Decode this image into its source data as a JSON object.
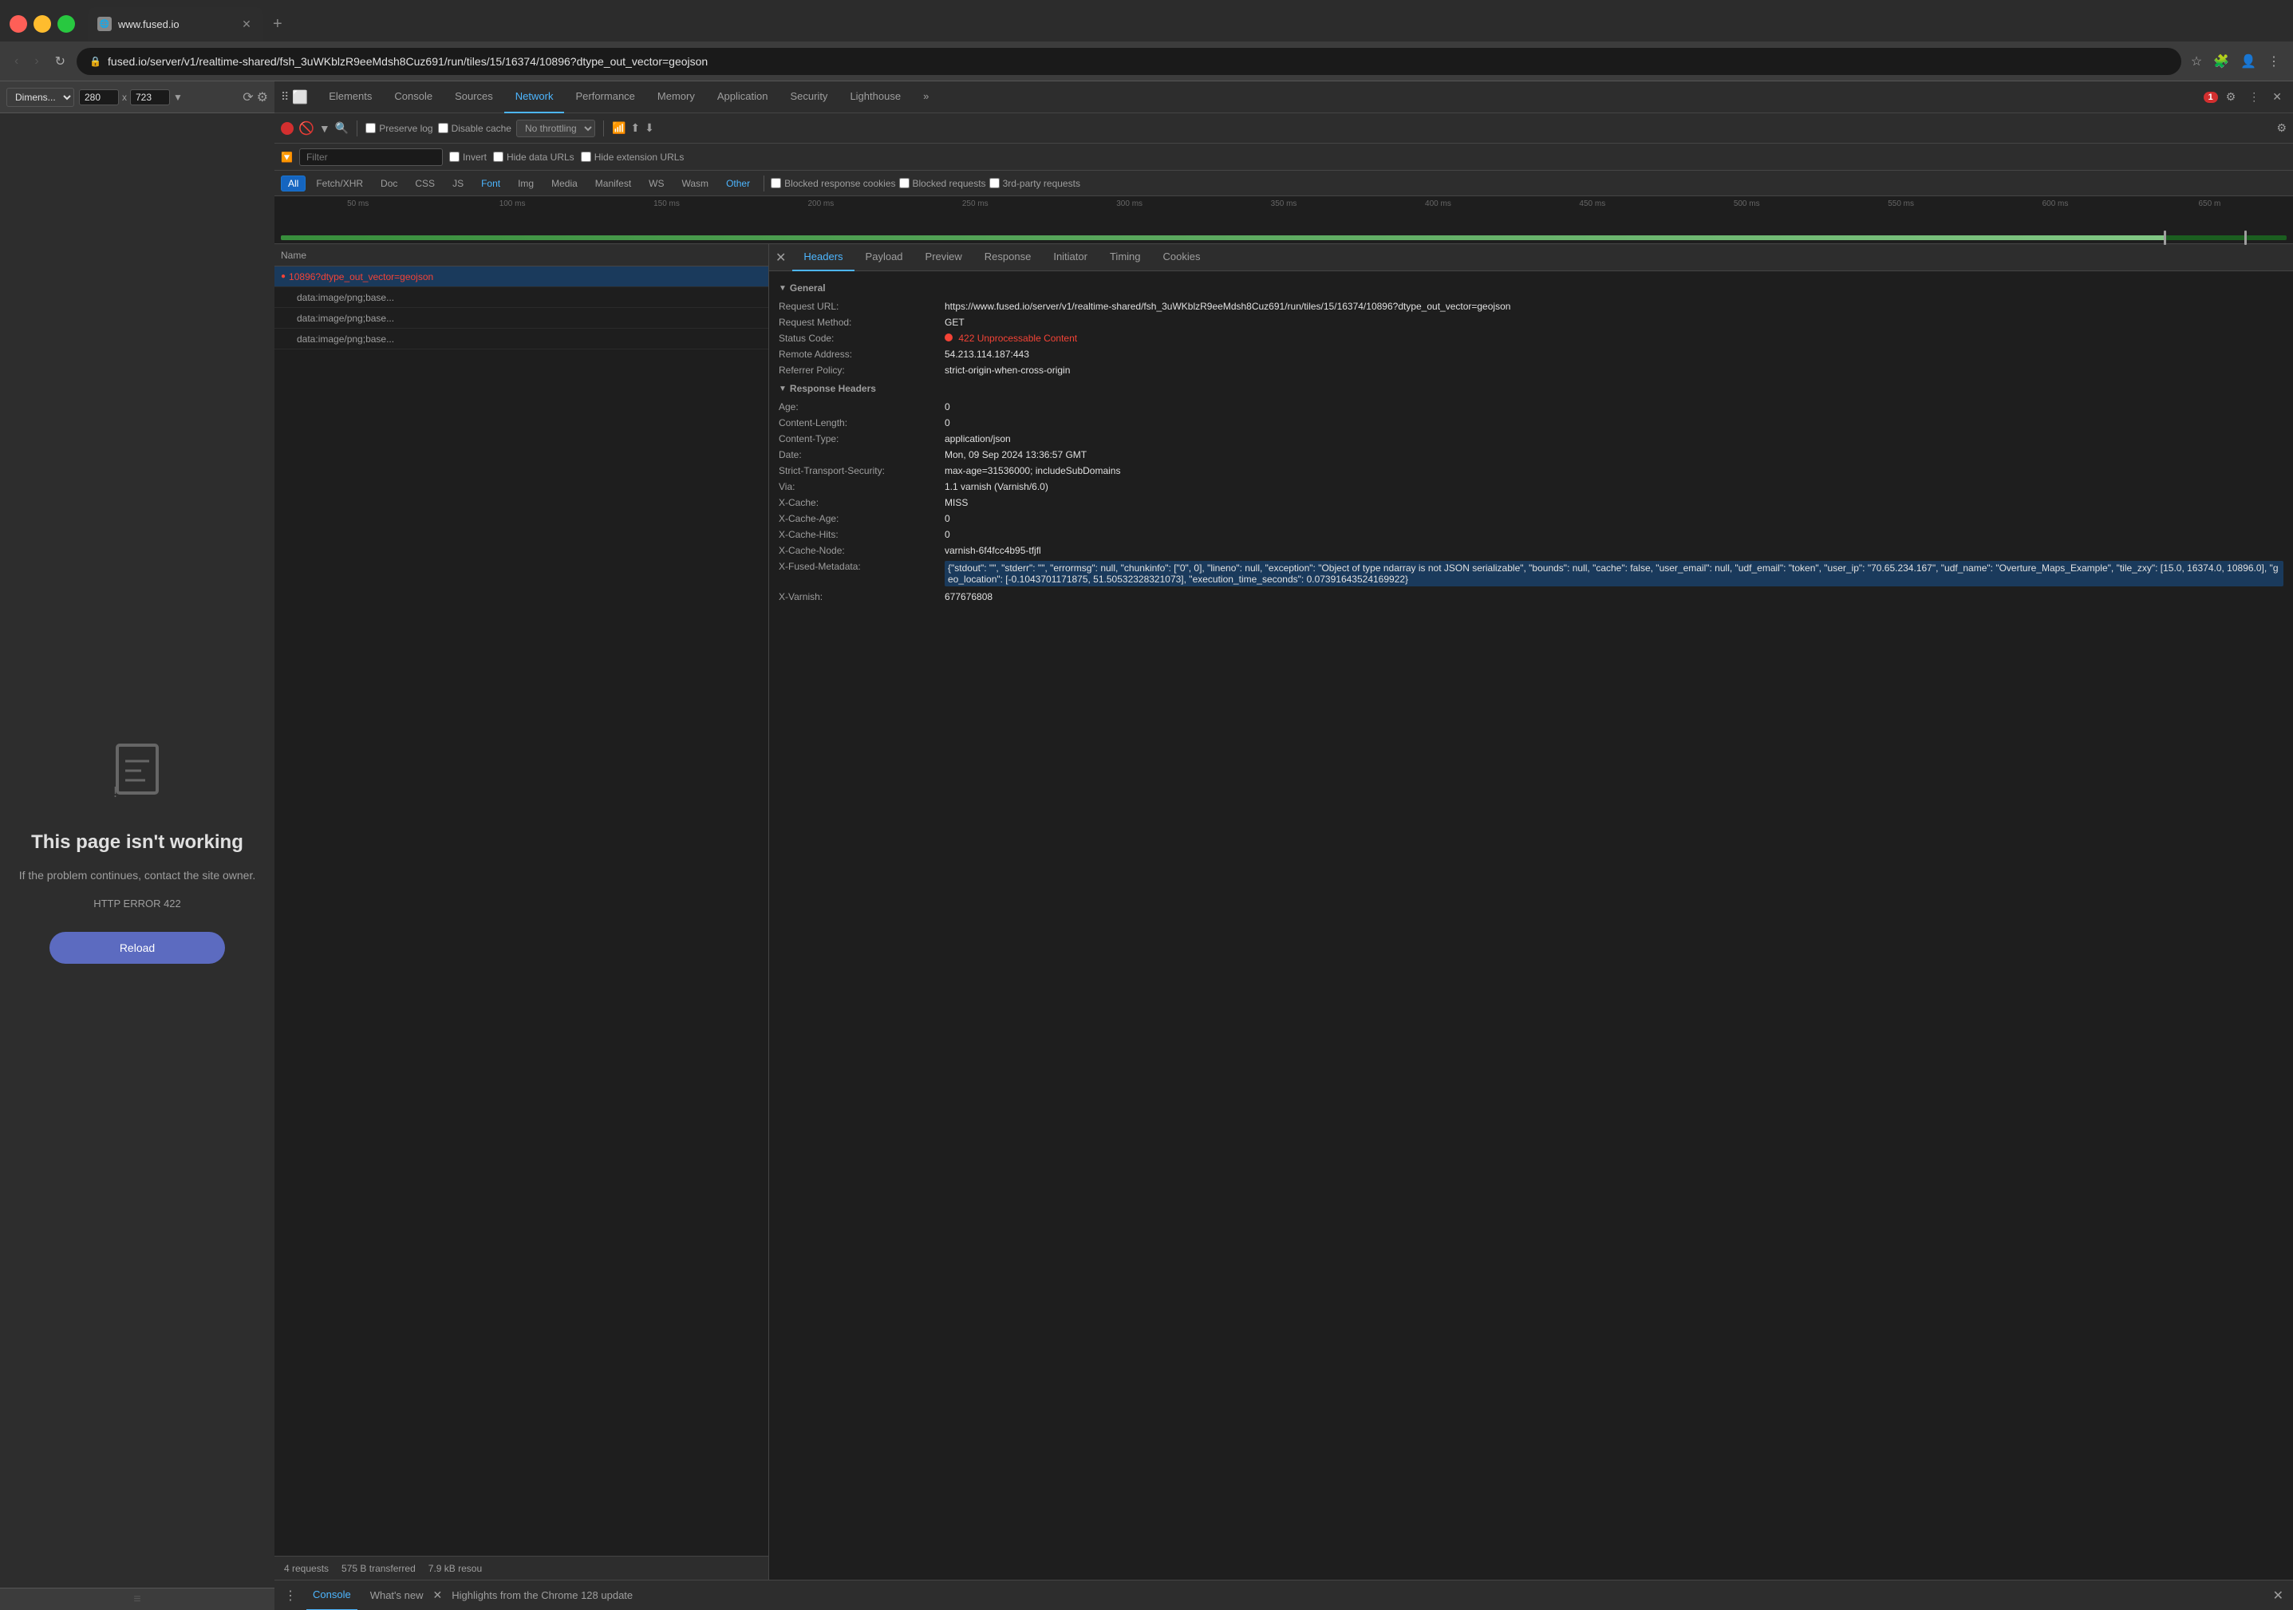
{
  "browser": {
    "tab_title": "www.fused.io",
    "url": "fused.io/server/v1/realtime-shared/fsh_3uWKblzR9eeMdsh8Cuz691/run/tiles/15/16374/10896?dtype_out_vector=geojson",
    "full_url": "https://www.fused.io/server/v1/realtime-shared/fsh_3uWKblzR9eeMdsh8Cuz691/run/tiles/15/16374/10896?dtype_out_vector=geojson",
    "new_tab_label": "+",
    "nav_back": "‹",
    "nav_forward": "›",
    "nav_refresh": "↻"
  },
  "page": {
    "error_title": "This page isn't working",
    "error_subtitle": "If the problem continues, contact\nthe site owner.",
    "error_code": "HTTP ERROR 422",
    "reload_label": "Reload",
    "error_icon": "📄"
  },
  "devtools": {
    "tabs": [
      "Elements",
      "Console",
      "Sources",
      "Network",
      "Performance",
      "Memory",
      "Application",
      "Security",
      "Lighthouse"
    ],
    "active_tab": "Network",
    "error_count": "1",
    "toolbar": {
      "record_title": "Record",
      "clear_title": "Clear",
      "filter_title": "Filter",
      "search_title": "Search",
      "preserve_log": "Preserve log",
      "disable_cache": "Disable cache",
      "throttle": "No throttling",
      "import_label": "Import",
      "export_label": "Export",
      "settings_title": "Settings"
    },
    "filter_bar": {
      "placeholder": "Filter",
      "invert": "Invert",
      "hide_data_urls": "Hide data URLs",
      "hide_extension_urls": "Hide extension URLs"
    },
    "type_filters": [
      "All",
      "Fetch/XHR",
      "Doc",
      "CSS",
      "JS",
      "Font",
      "Img",
      "Media",
      "Manifest",
      "WS",
      "Wasm",
      "Other"
    ],
    "active_type": "All",
    "blocked_cookies": "Blocked response cookies",
    "blocked_requests": "Blocked requests",
    "third_party": "3rd-party requests",
    "timeline_labels": [
      "50 ms",
      "100 ms",
      "150 ms",
      "200 ms",
      "250 ms",
      "300 ms",
      "350 ms",
      "400 ms",
      "450 ms",
      "500 ms",
      "550 ms",
      "600 ms",
      "650 m"
    ],
    "requests": [
      {
        "name": "10896?dtype_out_vector=geojson",
        "error": true,
        "indent": false
      },
      {
        "name": "data:image/png;base...",
        "error": false,
        "indent": true
      },
      {
        "name": "data:image/png;base...",
        "error": false,
        "indent": true
      },
      {
        "name": "data:image/png;base...",
        "error": false,
        "indent": true
      }
    ],
    "status_bar": {
      "requests": "4 requests",
      "transferred": "575 B transferred",
      "resources": "7.9 kB resou"
    },
    "details": {
      "tabs": [
        "Headers",
        "Payload",
        "Preview",
        "Response",
        "Initiator",
        "Timing",
        "Cookies"
      ],
      "active_tab": "Headers",
      "general_section": "General",
      "response_headers_section": "Response Headers",
      "general": {
        "request_url_key": "Request URL:",
        "request_url_val": "https://www.fused.io/server/v1/realtime-shared/fsh_3uWKblzR9eeMdsh8Cuz691/run/tiles/15/16374/10896?dtype_out_vector=geojson",
        "method_key": "Request Method:",
        "method_val": "GET",
        "status_key": "Status Code:",
        "status_val": "422 Unprocessable Content",
        "remote_key": "Remote Address:",
        "remote_val": "54.213.114.187:443",
        "referrer_key": "Referrer Policy:",
        "referrer_val": "strict-origin-when-cross-origin"
      },
      "response_headers": [
        {
          "key": "Age:",
          "val": "0"
        },
        {
          "key": "Content-Length:",
          "val": "0"
        },
        {
          "key": "Content-Type:",
          "val": "application/json"
        },
        {
          "key": "Date:",
          "val": "Mon, 09 Sep 2024 13:36:57 GMT"
        },
        {
          "key": "Strict-Transport-Security:",
          "val": "max-age=31536000; includeSubDomains"
        },
        {
          "key": "Via:",
          "val": "1.1 varnish (Varnish/6.0)"
        },
        {
          "key": "X-Cache:",
          "val": "MISS"
        },
        {
          "key": "X-Cache-Age:",
          "val": "0"
        },
        {
          "key": "X-Cache-Hits:",
          "val": "0"
        },
        {
          "key": "X-Cache-Node:",
          "val": "varnish-6f4fcc4b95-tfjfl"
        },
        {
          "key": "X-Fused-Metadata:",
          "val": "{\"stdout\": \"\", \"stderr\": \"\", \"errormsg\": null, \"chunkinfo\": [\"0\", 0], \"lineno\": null, \"exception\": \"Object of type ndarray is not JSON serializable\", \"bounds\": null, \"cache\": false, \"user_email\": null, \"udf_email\": \"token\", \"user_ip\": \"70.65.234.167\", \"udf_name\": \"Overture_Maps_Example\", \"tile_zxy\": [15.0, 16374.0, 10896.0], \"geo_location\": [-0.1043701171875, 51.50532328321073], \"execution_time_seconds\": 0.07391643524169922}"
        },
        {
          "key": "X-Varnish:",
          "val": "677676808"
        }
      ]
    },
    "console_bar": {
      "console_label": "Console",
      "whats_new_label": "What's new",
      "highlights": "Highlights from the Chrome 128 update"
    }
  },
  "page_toolbar": {
    "dimensions_label": "Dimens...",
    "width": "280",
    "x_label": "x",
    "height": "723"
  }
}
